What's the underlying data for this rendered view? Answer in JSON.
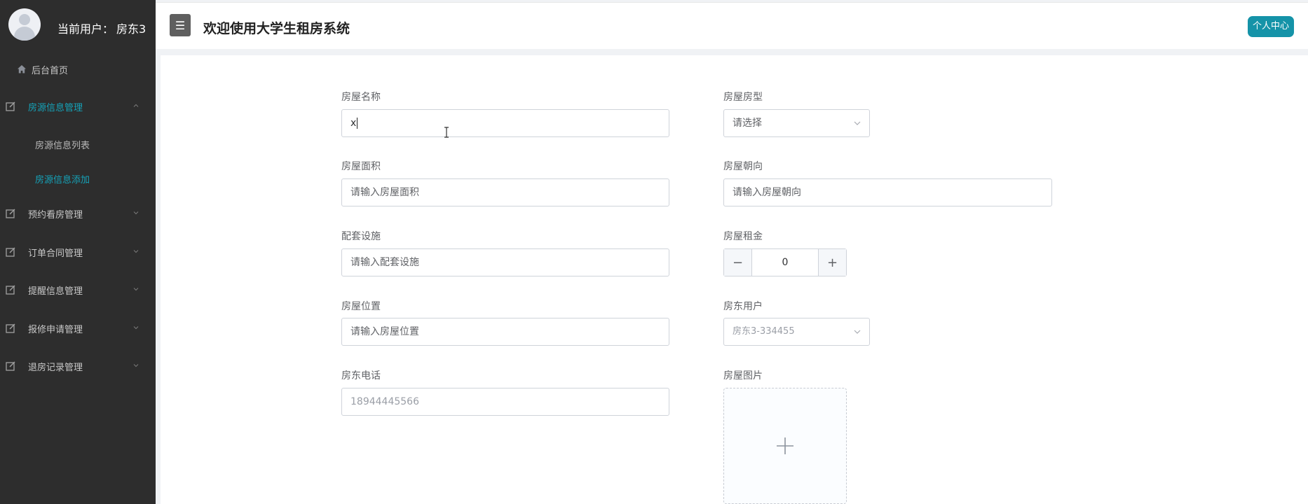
{
  "sidebar": {
    "user_label": "当前用户：",
    "user_name": "房东3",
    "home": "后台首页",
    "menu": [
      {
        "label": "房源信息管理",
        "active": true
      },
      {
        "label": "预约看房管理"
      },
      {
        "label": "订单合同管理"
      },
      {
        "label": "提醒信息管理"
      },
      {
        "label": "报修申请管理"
      },
      {
        "label": "退房记录管理"
      }
    ],
    "submenu": [
      {
        "label": "房源信息列表"
      },
      {
        "label": "房源信息添加",
        "active": true
      }
    ]
  },
  "header": {
    "menu_toggle": "☰",
    "title": "欢迎使用大学生租房系统",
    "profile": "个人中心"
  },
  "form": {
    "name": {
      "label": "房屋名称",
      "value": "x"
    },
    "type": {
      "label": "房屋房型",
      "placeholder": "请选择"
    },
    "area": {
      "label": "房屋面积",
      "placeholder": "请输入房屋面积"
    },
    "orientation": {
      "label": "房屋朝向",
      "placeholder": "请输入房屋朝向"
    },
    "facilities": {
      "label": "配套设施",
      "placeholder": "请输入配套设施"
    },
    "rent": {
      "label": "房屋租金",
      "value": "0",
      "minus": "−",
      "plus": "+"
    },
    "location": {
      "label": "房屋位置",
      "placeholder": "请输入房屋位置"
    },
    "landlord": {
      "label": "房东用户",
      "value": "房东3-334455"
    },
    "phone": {
      "label": "房东电话",
      "value": "18944445566"
    },
    "image": {
      "label": "房屋图片"
    }
  },
  "colors": {
    "sidebar_bg": "#2d2d2d",
    "accent": "#15a2b8",
    "profile_button": "#1593a8"
  }
}
